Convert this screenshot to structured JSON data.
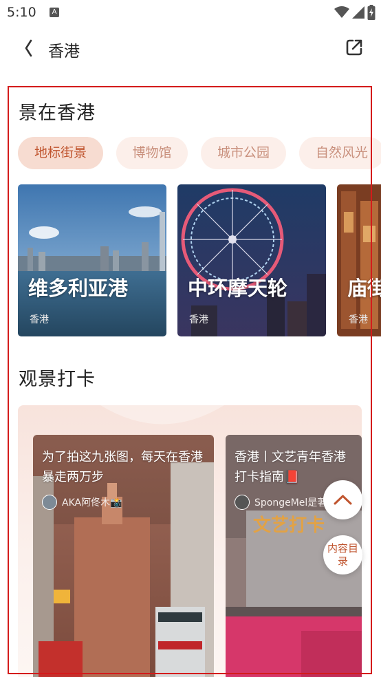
{
  "status_bar": {
    "time": "5:10",
    "notification_icon": "android-a-icon"
  },
  "nav": {
    "title": "香港"
  },
  "scenic": {
    "title": "景在香港",
    "chips": [
      "地标街景",
      "博物馆",
      "城市公园",
      "自然风光"
    ],
    "cards": [
      {
        "name": "维多利亚港",
        "location": "香港"
      },
      {
        "name": "中环摩天轮",
        "location": "香港"
      },
      {
        "name": "庙街",
        "location": "香港"
      }
    ]
  },
  "checkin": {
    "title": "观景打卡",
    "notes": [
      {
        "title": "为了拍这九张图，每天在香港暴走两万步",
        "author": "AKA阿佟木📸"
      },
      {
        "title": "香港丨文艺青年香港打卡指南📕",
        "author": "SpongeMel是著"
      }
    ]
  },
  "fab": {
    "toc_label": "内容目录"
  },
  "colors": {
    "accent": "#c0552f",
    "chip_bg": "#fcefea",
    "chip_active_bg": "#f7dcd1",
    "highlight_frame": "#d41b1b"
  }
}
